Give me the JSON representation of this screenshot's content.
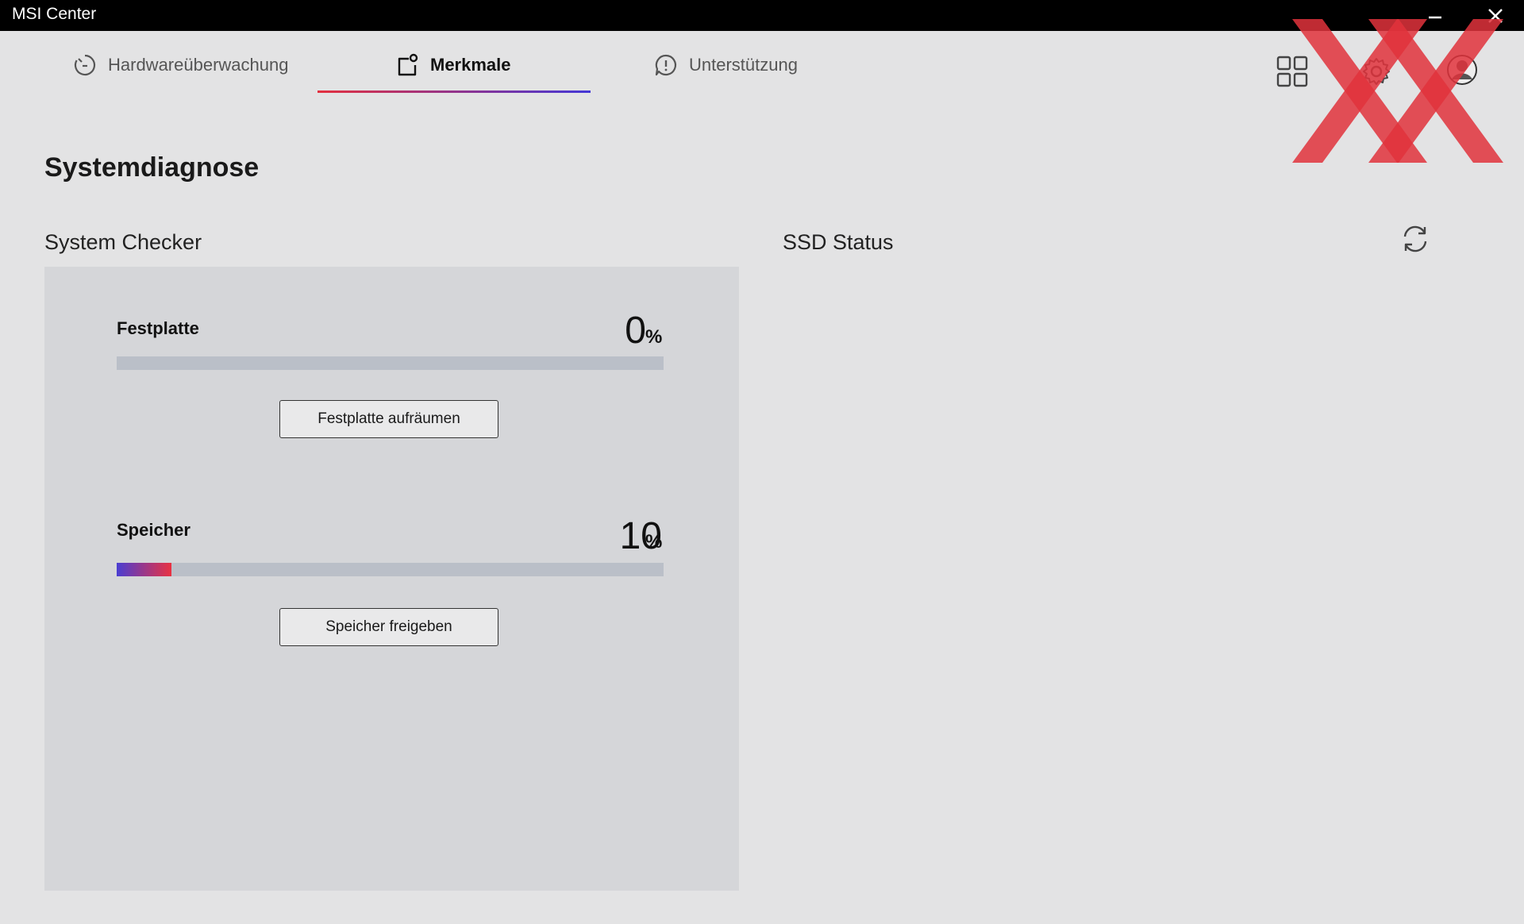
{
  "window": {
    "title": "MSI Center"
  },
  "tabs": [
    {
      "label": "Hardwareüberwachung",
      "icon": "gauge-icon",
      "active": false
    },
    {
      "label": "Merkmale",
      "icon": "features-icon",
      "active": true
    },
    {
      "label": "Unterstützung",
      "icon": "support-icon",
      "active": false
    }
  ],
  "header_icons": [
    "apps-grid-icon",
    "settings-gear-icon",
    "profile-icon"
  ],
  "page": {
    "title": "Systemdiagnose"
  },
  "system_checker": {
    "title": "System Checker",
    "items": [
      {
        "label": "Festplatte",
        "value": "0",
        "unit": "%",
        "percent": 0,
        "button": "Festplatte aufräumen"
      },
      {
        "label": "Speicher",
        "value": "10",
        "unit": "%",
        "percent": 10,
        "button": "Speicher freigeben"
      }
    ]
  },
  "ssd_status": {
    "title": "SSD Status"
  },
  "colors": {
    "accent_start": "#4a3ed2",
    "accent_end": "#e93242",
    "watermark": "#e0323c"
  }
}
